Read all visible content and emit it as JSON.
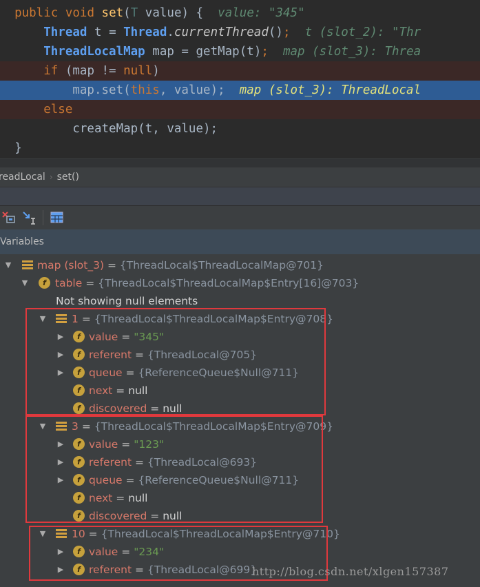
{
  "editor": {
    "lines": {
      "l1": {
        "kw1": "public",
        "kw2": "void",
        "fn": "set",
        "p1": "T",
        "p2": "value",
        "hint": "value: \"345\""
      },
      "l2": {
        "cls1": "Thread",
        "var": "t",
        "cls2": "Thread",
        "call": "currentThread",
        "hint": "t (slot_2): \"Thr"
      },
      "l3": {
        "cls": "ThreadLocalMap",
        "var": "map",
        "call": "getMap",
        "arg": "t",
        "hint": "map (slot_3): Threa"
      },
      "l4": {
        "kw": "if",
        "cond": "(map != ",
        "nul": "null",
        "close": ")"
      },
      "l5": {
        "recv": "map.set(",
        "this": "this",
        "rest": ", value);",
        "hint": "map (slot_3): ThreadLocal"
      },
      "l6": {
        "kw": "else"
      },
      "l7": {
        "code": "createMap(t, value);"
      },
      "l8": {
        "code": "}"
      }
    }
  },
  "breadcrumb": {
    "items": [
      "readLocal",
      "set()"
    ]
  },
  "variables": {
    "title": "Variables",
    "rows": [
      {
        "name": "map (slot_3)",
        "value": "{ThreadLocal$ThreadLocalMap@701}"
      },
      {
        "name": "table",
        "value": "{ThreadLocal$ThreadLocalMap$Entry[16]@703}"
      },
      {
        "text": "Not showing null elements"
      },
      {
        "name": "1",
        "value": "{ThreadLocal$ThreadLocalMap$Entry@708}"
      },
      {
        "name": "value",
        "value": "\"345\""
      },
      {
        "name": "referent",
        "value": "{ThreadLocal@705}"
      },
      {
        "name": "queue",
        "value": "{ReferenceQueue$Null@711}"
      },
      {
        "name": "next",
        "value": "null"
      },
      {
        "name": "discovered",
        "value": "null"
      },
      {
        "name": "3",
        "value": "{ThreadLocal$ThreadLocalMap$Entry@709}"
      },
      {
        "name": "value",
        "value": "\"123\""
      },
      {
        "name": "referent",
        "value": "{ThreadLocal@693}"
      },
      {
        "name": "queue",
        "value": "{ReferenceQueue$Null@711}"
      },
      {
        "name": "next",
        "value": "null"
      },
      {
        "name": "discovered",
        "value": "null"
      },
      {
        "name": "10",
        "value": "{ThreadLocal$ThreadLocalMap$Entry@710}"
      },
      {
        "name": "value",
        "value": "\"234\""
      },
      {
        "name": "referent",
        "value": "{ThreadLocal@699}"
      }
    ]
  },
  "icons": {
    "field": "f"
  },
  "watermark": "http://blog.csdn.net/xlgen157387",
  "colors": {
    "highlight_box": "#e0393d",
    "selected_line": "#2e5c94",
    "breakpoint_line": "#3b2826"
  }
}
